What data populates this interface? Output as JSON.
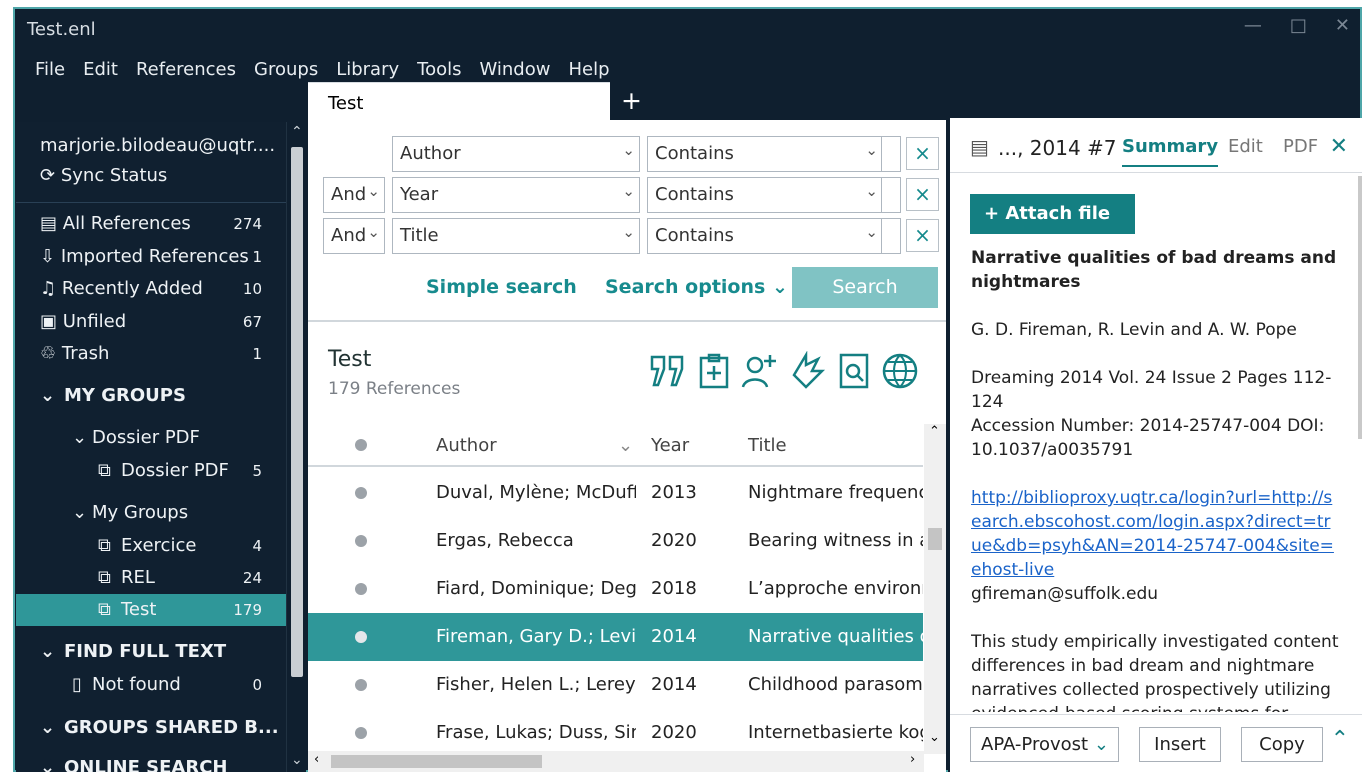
{
  "window": {
    "title": "Test.enl",
    "minimize": "—",
    "maximize": "□",
    "close": "✕"
  },
  "menu": [
    "File",
    "Edit",
    "References",
    "Groups",
    "Library",
    "Tools",
    "Window",
    "Help"
  ],
  "sidebar": {
    "account": "marjorie.bilodeau@uqtr....",
    "sync_status": "Sync Status",
    "items": [
      {
        "label": "All References",
        "count": "274"
      },
      {
        "label": "Imported References",
        "count": "1"
      },
      {
        "label": "Recently Added",
        "count": "10"
      },
      {
        "label": "Unfiled",
        "count": "67"
      },
      {
        "label": "Trash",
        "count": "1"
      }
    ],
    "my_groups": "MY GROUPS",
    "dossier_set": "Dossier PDF",
    "dossier_group": {
      "label": "Dossier PDF",
      "count": "5"
    },
    "group_set": "My Groups",
    "groups": [
      {
        "label": "Exercice",
        "count": "4"
      },
      {
        "label": "REL",
        "count": "24"
      },
      {
        "label": "Test",
        "count": "179"
      }
    ],
    "find_full_text": "FIND FULL TEXT",
    "not_found": {
      "label": "Not found",
      "count": "0"
    },
    "groups_shared": "GROUPS SHARED B...",
    "online_search": "ONLINE SEARCH"
  },
  "tab": {
    "label": "Test",
    "add": "+"
  },
  "search": {
    "rows": [
      {
        "connector": "",
        "field": "Author",
        "operator": "Contains"
      },
      {
        "connector": "And",
        "field": "Year",
        "operator": "Contains"
      },
      {
        "connector": "And",
        "field": "Title",
        "operator": "Contains"
      }
    ],
    "simple": "Simple search",
    "options": "Search options",
    "button": "Search"
  },
  "library": {
    "title": "Test",
    "count": "179 References"
  },
  "table": {
    "headers": {
      "author": "Author",
      "year": "Year",
      "title": "Title"
    },
    "rows": [
      {
        "author": "Duval, Mylène; McDuff,...",
        "year": "2013",
        "title": "Nightmare frequency, "
      },
      {
        "author": "Ergas, Rebecca",
        "year": "2020",
        "title": "Bearing witness in asyl"
      },
      {
        "author": "Fiard, Dominique; Deg...",
        "year": "2018",
        "title": "L’approche environner"
      },
      {
        "author": "Fireman, Gary D.; Levin,...",
        "year": "2014",
        "title": "Narrative qualities of b"
      },
      {
        "author": "Fisher, Helen L.; Lereya,...",
        "year": "2014",
        "title": "Childhood parasomnia"
      },
      {
        "author": "Frase, Lukas; Duss, Sim...",
        "year": "2020",
        "title": "Internetbasierte kognit"
      }
    ]
  },
  "summary": {
    "title": "..., 2014 #7",
    "tabs": [
      "Summary",
      "Edit",
      "PDF"
    ],
    "attach": "Attach file",
    "ref_title": "Narrative qualities of bad dreams and nightmares",
    "authors": "G. D. Fireman, R. Levin and A. W. Pope",
    "journal": "Dreaming 2014 Vol. 24 Issue 2 Pages 112-124",
    "accession": "Accession Number: 2014-25747-004 DOI: 10.1037/a0035791",
    "url": "http://biblioproxy.uqtr.ca/login?url=http://search.ebscohost.com/login.aspx?direct=true&db=psyh&AN=2014-25747-004&site=ehost-live",
    "email": "gfireman@suffolk.edu",
    "abstract": "This study empirically investigated content differences in bad dream and nightmare narratives collected prospectively utilizing evidenced-based scoring systems for waking"
  },
  "footer": {
    "style": "APA-Provost",
    "insert": "Insert",
    "copy": "Copy"
  }
}
